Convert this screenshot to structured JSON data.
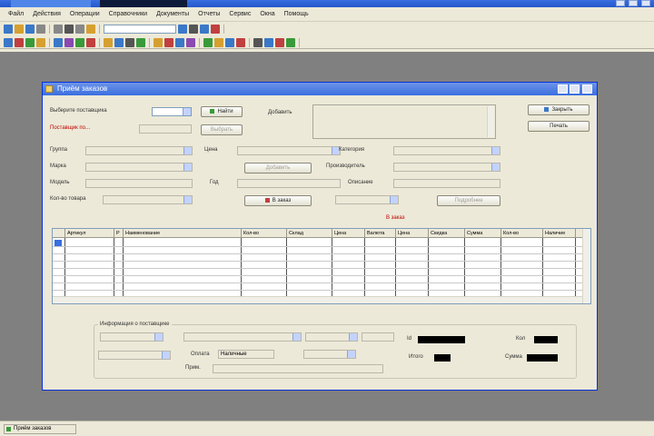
{
  "app": {
    "menu": [
      "Файл",
      "Действия",
      "Операции",
      "Справочники",
      "Документы",
      "Отчеты",
      "Сервис",
      "Окна",
      "Помощь"
    ]
  },
  "toolbar": {
    "row1": [
      "#3a78c8",
      "#d6a030",
      "#3a78c8",
      "#888",
      "#888",
      "#555",
      "#888",
      "#d6a030",
      "#3a78c8",
      "#555",
      "#3a78c8",
      "#c04040"
    ],
    "row2": [
      "#3a78c8",
      "#c04040",
      "#3a9a3a",
      "#d6a030",
      "#3a78c8",
      "#8a4ab0",
      "#3a9a3a",
      "#c04040",
      "#d6a030",
      "#3a78c8",
      "#555",
      "#3a9a3a",
      "#d6a030",
      "#c04040",
      "#3a78c8",
      "#8a4ab0",
      "#3a9a3a",
      "#d6a030",
      "#3a78c8",
      "#c04040",
      "#555",
      "#3a78c8",
      "#c04040",
      "#3a9a3a"
    ]
  },
  "dialog": {
    "title": "Приём заказов",
    "fields": {
      "select_supplier": "Выберите поставщика",
      "period": "Поставщик по...",
      "group": "Группа",
      "brand": "Марка",
      "model": "Модель",
      "count_goods": "Кол-во товара",
      "price": "Цена",
      "category": "Категория",
      "manufacturer": "Производитель",
      "year": "Год",
      "description": "Описание",
      "notes": "Примечание"
    },
    "buttons": {
      "search": "Найти",
      "add": "Добавить",
      "select": "Выбрать",
      "to_order": "В заказ",
      "more": "Подробнее",
      "close": "Закрыть",
      "print": "Печать"
    },
    "section_title": "В заказ",
    "grid_columns": [
      "Артикул",
      "Р",
      "Наименование",
      "Кол-во",
      "Склад",
      "Цена",
      "Валюта",
      "Цена",
      "Скидка",
      "Сумма",
      "Кол-во",
      "Наличие",
      "С"
    ],
    "group_title": "Информация о поставщике",
    "bottom": {
      "payment_label": "Оплата",
      "payment_value": "Наличные",
      "note_label": "Прим.",
      "id_label": "Id",
      "total_label": "Итого",
      "qty_label": "Кол",
      "sum_label": "Сумма"
    }
  },
  "status": {
    "panel": "Приём заказов"
  }
}
